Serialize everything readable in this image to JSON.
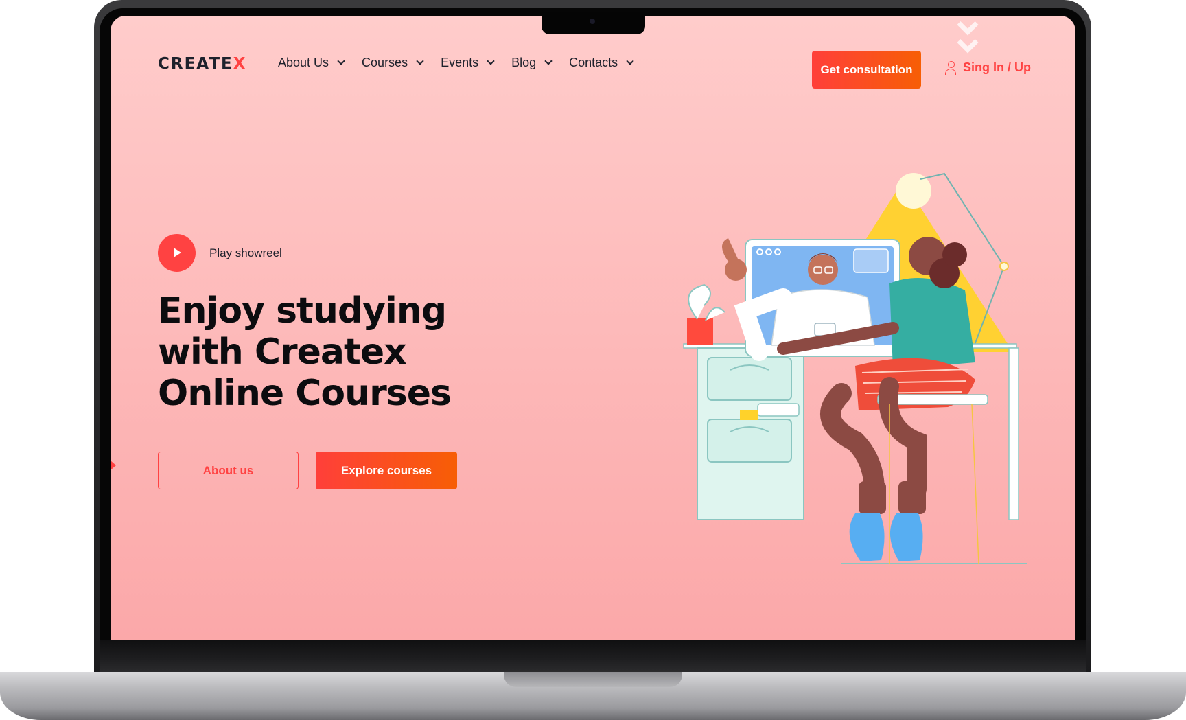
{
  "header": {
    "logo_text": "CREATE",
    "logo_accent": "X",
    "nav": [
      {
        "label": "About Us"
      },
      {
        "label": "Courses"
      },
      {
        "label": "Events"
      },
      {
        "label": "Blog"
      },
      {
        "label": "Contacts"
      }
    ],
    "consult_label": "Get consultation",
    "signin_label": "Sing In / Up"
  },
  "hero": {
    "showreel_label": "Play showreel",
    "title": "Enjoy studying with Createx Online Courses",
    "about_label": "About us",
    "explore_label": "Explore courses"
  },
  "colors": {
    "accent": "#ff4242",
    "gradient_end": "#f75e05",
    "background_top": "#ffcccb",
    "background_bottom": "#fba8a9",
    "text_dark": "#1e212c"
  },
  "icons": [
    "play-icon",
    "chevron-down-icon",
    "user-icon",
    "scroll-down-icon"
  ]
}
